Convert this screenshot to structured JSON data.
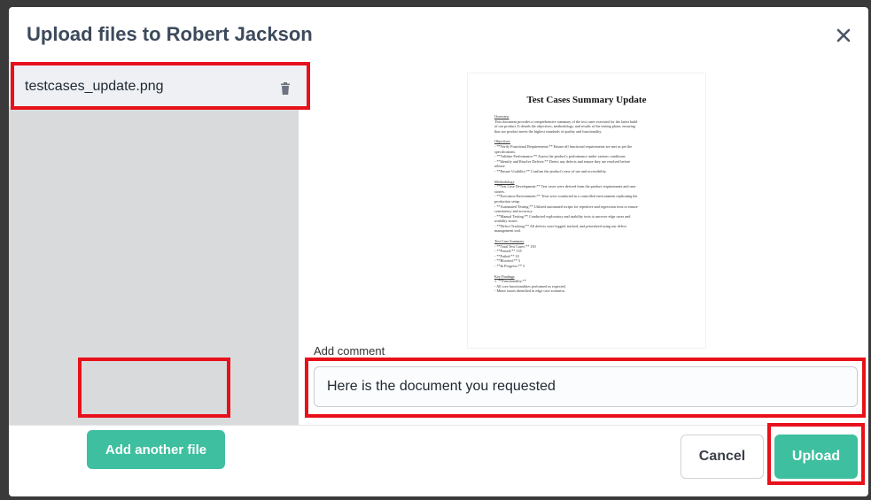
{
  "modal": {
    "title": "Upload files to Robert Jackson",
    "close_icon": "close-icon"
  },
  "files": [
    {
      "name": "testcases_update.png",
      "delete_icon": "trash-icon"
    }
  ],
  "add_file_label": "Add another file",
  "preview": {
    "title": "Test Cases Summary Update",
    "sections": [
      {
        "heading": "Overview",
        "lines": [
          "This document provides a comprehensive summary of the test cases executed for the latest build",
          "of our product. It details the objectives, methodology, and results of the testing phase, ensuring",
          "that our product meets the highest standards of quality and functionality."
        ]
      },
      {
        "heading": "Objectives",
        "lines": [
          "- **Verify Functional Requirements:** Ensure all functional requirements are met as per the",
          "specifications.",
          "- **Validate Performance:** Assess the product's performance under various conditions.",
          "- **Identify and Resolve Defects:** Detect any defects and ensure they are resolved before",
          "release.",
          "- **Ensure Usability:** Confirm the product's ease of use and accessibility."
        ]
      },
      {
        "heading": "Methodology",
        "lines": [
          "- **Test Case Development:** Test cases were derived from the product requirements and user",
          "stories.",
          "- **Execution Environment:** Tests were conducted in a controlled environment replicating the",
          "production setup.",
          "- **Automated Testing:** Utilized automated scripts for repetitive and regression tests to ensure",
          "consistency and accuracy.",
          "- **Manual Testing:** Conducted exploratory and usability tests to uncover edge cases and",
          "usability issues.",
          "- **Defect Tracking:** All defects were logged, tracked, and prioritized using our defect",
          "management tool."
        ]
      },
      {
        "heading": "Test Case Summary",
        "lines": [
          "- **Total Test Cases:** 150",
          "- **Passed:** 135",
          "- **Failed:** 10",
          "- **Blocked:** 5",
          "- **In Progress:** 5"
        ]
      },
      {
        "heading": "Key Findings",
        "lines": [
          "1. **Functionality:**",
          "- All core functionalities performed as expected.",
          "- Minor issues identified in edge case scenarios."
        ]
      }
    ]
  },
  "comment": {
    "label": "Add comment",
    "value": "Here is the document you requested"
  },
  "actions": {
    "cancel_label": "Cancel",
    "upload_label": "Upload"
  },
  "colors": {
    "accent": "#3ebf9f",
    "highlight": "#e8101a",
    "sidebar": "#d9dadc",
    "title": "#3d4a5c"
  }
}
